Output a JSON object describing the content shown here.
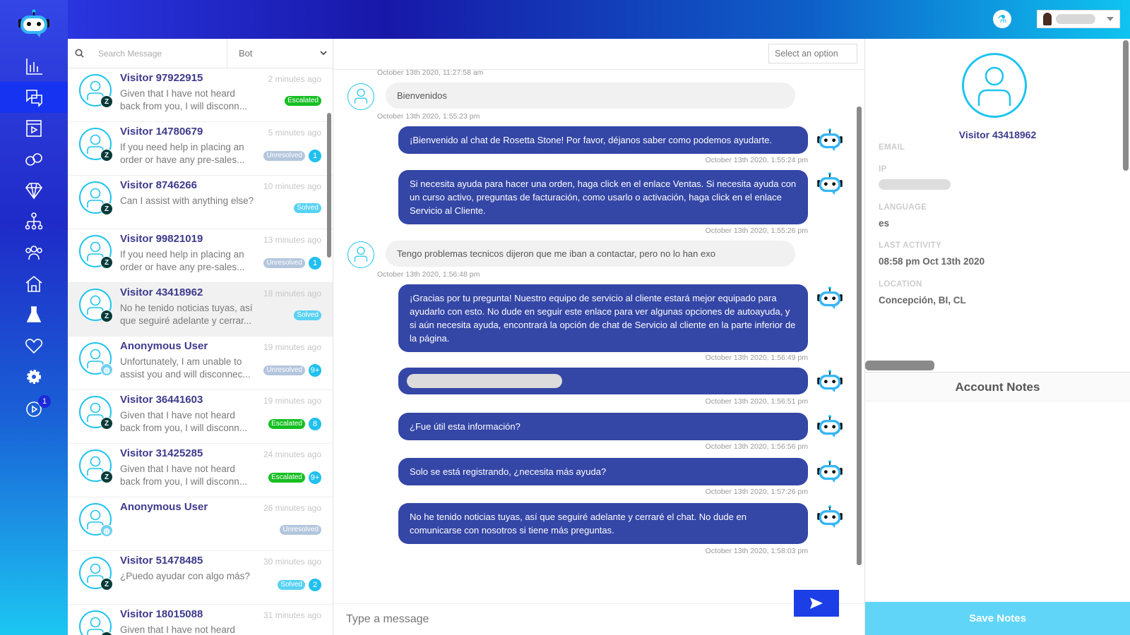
{
  "colors": {
    "accent": "#3446a6",
    "brand_cyan": "#1ec4ef",
    "escalated": "#16bf22",
    "unresolved": "#b4c6dd",
    "solved": "#58d2f3"
  },
  "sidebar": {
    "items": [
      {
        "icon": "bar-chart-icon"
      },
      {
        "icon": "chat-bubbles-icon",
        "active": true
      },
      {
        "icon": "video-play-icon"
      },
      {
        "icon": "qa-bubbles-icon"
      },
      {
        "icon": "diamond-icon"
      },
      {
        "icon": "org-chart-icon"
      },
      {
        "icon": "users-icon"
      },
      {
        "icon": "home-icon"
      },
      {
        "icon": "flask-icon"
      },
      {
        "icon": "heart-icon"
      },
      {
        "icon": "gear-icon"
      },
      {
        "icon": "play-circle-icon",
        "badge": "1"
      }
    ]
  },
  "search": {
    "placeholder": "Search Message",
    "filter": "Bot"
  },
  "conversations": [
    {
      "name": "Visitor 97922915",
      "time": "2 minutes ago",
      "preview": "Given that I have not heard back from you, I will disconn...",
      "status": "Escalated",
      "count": "",
      "source": "zendesk"
    },
    {
      "name": "Visitor 14780679",
      "time": "5 minutes ago",
      "preview": "If you need help in placing an order or have any pre-sales...",
      "status": "Unresolved",
      "count": "1",
      "source": "zendesk"
    },
    {
      "name": "Visitor 8746266",
      "time": "10 minutes ago",
      "preview": "Can I assist with anything else?",
      "status": "Solved",
      "count": "",
      "source": "zendesk"
    },
    {
      "name": "Visitor 99821019",
      "time": "13 minutes ago",
      "preview": "If you need help in placing an order or have any pre-sales...",
      "status": "Unresolved",
      "count": "1",
      "source": "zendesk"
    },
    {
      "name": "Visitor 43418962",
      "time": "18 minutes ago",
      "preview": "No he tenido noticias tuyas, así que seguiré adelante y cerrar...",
      "status": "Solved",
      "count": "",
      "source": "zendesk",
      "selected": true
    },
    {
      "name": "Anonymous User",
      "time": "19 minutes ago",
      "preview": "Unfortunately, I am unable to assist you and will disconnec...",
      "status": "Unresolved",
      "count": "9+",
      "source": "web"
    },
    {
      "name": "Visitor 36441603",
      "time": "19 minutes ago",
      "preview": "Given that I have not heard back from you, I will disconn...",
      "status": "Escalated",
      "count": "8",
      "source": "zendesk"
    },
    {
      "name": "Visitor 31425285",
      "time": "24 minutes ago",
      "preview": "Given that I have not heard back from you, I will disconn...",
      "status": "Escalated",
      "count": "9+",
      "source": "zendesk"
    },
    {
      "name": "Anonymous User",
      "time": "26 minutes ago",
      "preview": "",
      "status": "Unresolved",
      "count": "",
      "source": "web"
    },
    {
      "name": "Visitor 51478485",
      "time": "30 minutes ago",
      "preview": "¿Puedo ayudar con algo más?",
      "status": "Solved",
      "count": "2",
      "source": "zendesk"
    },
    {
      "name": "Visitor 18015088",
      "time": "31 minutes ago",
      "preview": "Given that I have not heard back from you, I will disconn...",
      "status": "",
      "count": "",
      "source": "zendesk"
    }
  ],
  "chat": {
    "select_placeholder": "Select an option",
    "top_timestamp": "October 13th 2020, 11:27:58 am",
    "messages": [
      {
        "from": "user",
        "text": "Bienvenidos",
        "time": "October 13th 2020, 1:55:23 pm"
      },
      {
        "from": "bot",
        "text": "¡Bienvenido al chat de Rosetta Stone! Por favor, déjanos saber como podemos ayudarte.",
        "time": "October 13th 2020, 1:55:24 pm"
      },
      {
        "from": "bot",
        "text": "Si necesita ayuda para hacer una orden, haga click en el enlace Ventas. Si necesita ayuda con un curso activo, preguntas de facturación, como usarlo o activación, haga click en el enlace Servicio al Cliente.",
        "time": "October 13th 2020, 1:55:26 pm"
      },
      {
        "from": "user",
        "text": "Tengo problemas tecnicos dijeron que me iban a contactar, pero no lo han exo",
        "time": "October 13th 2020, 1:56:48 pm"
      },
      {
        "from": "bot",
        "text": "¡Gracias por tu pregunta! Nuestro equipo de servicio al cliente estará mejor equipado para ayudarlo con esto. No dude en seguir este enlace para ver algunas opciones de autoayuda, y si aún necesita ayuda, encontrará la opción de chat de Servicio al cliente en la parte inferior de la página.",
        "time": "October 13th 2020, 1:56:49 pm"
      },
      {
        "from": "bot",
        "text": "",
        "redacted": true,
        "time": "October 13th 2020, 1:56:51 pm"
      },
      {
        "from": "bot",
        "text": "¿Fue útil esta información?",
        "time": "October 13th 2020, 1:56:56 pm"
      },
      {
        "from": "bot",
        "text": "Solo se está registrando, ¿necesita más ayuda?",
        "time": "October 13th 2020, 1:57:26 pm"
      },
      {
        "from": "bot",
        "text": "No he tenido noticias tuyas, así que seguiré adelante y cerraré el chat. No dude en comunicarse con nosotros si tiene más preguntas.",
        "time": "October 13th 2020, 1:58:03 pm"
      }
    ],
    "input_placeholder": "Type a message"
  },
  "profile": {
    "name": "Visitor 43418962",
    "email_label": "EMAIL",
    "ip_label": "IP",
    "language_label": "LANGUAGE",
    "language": "es",
    "last_activity_label": "LAST ACTIVITY",
    "last_activity": "08:58 pm Oct 13th 2020",
    "location_label": "LOCATION",
    "location": "Concepción, BI, CL",
    "notes_title": "Account Notes",
    "save_label": "Save Notes"
  }
}
